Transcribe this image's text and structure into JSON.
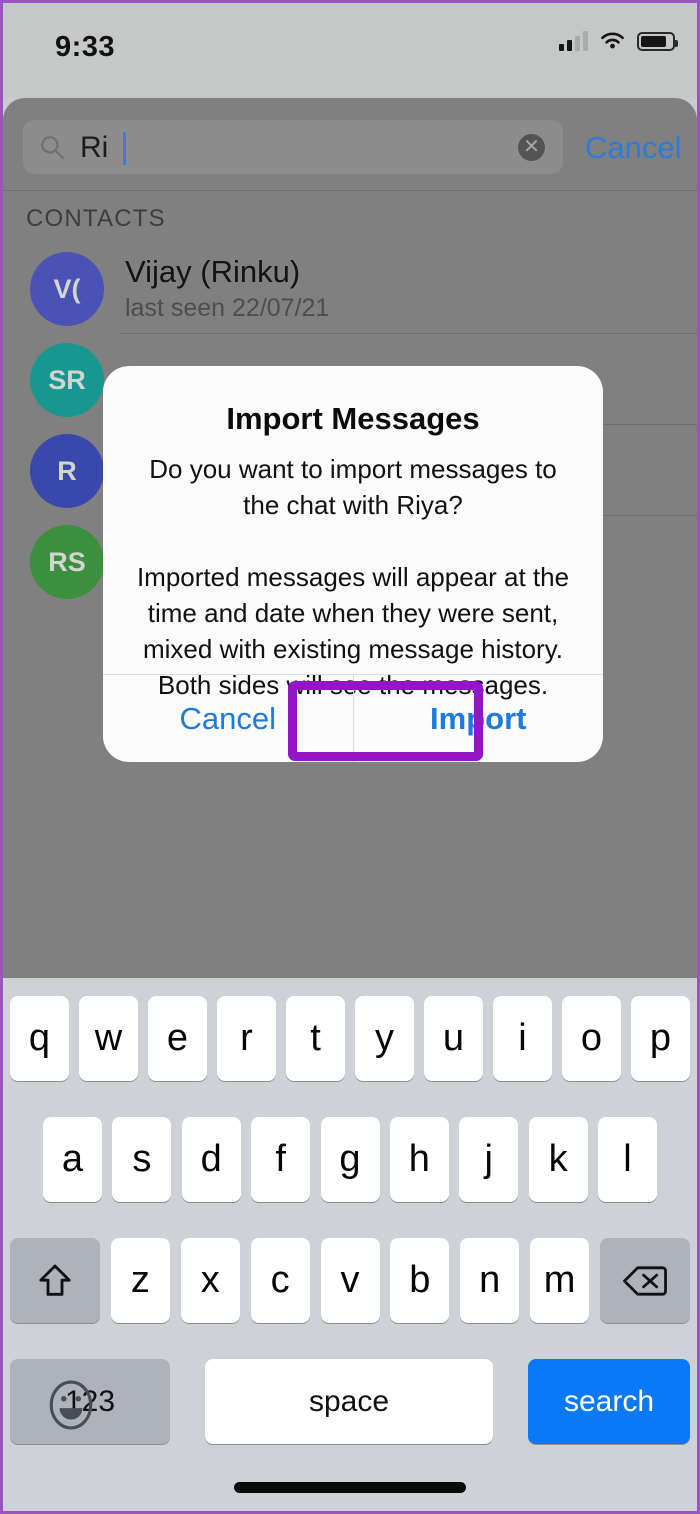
{
  "status_bar": {
    "time": "9:33",
    "cellular_icon": "cellular-signal-icon",
    "wifi_icon": "wifi-icon",
    "battery_icon": "battery-icon"
  },
  "search": {
    "icon": "search-icon",
    "value": "Ri",
    "clear_icon": "clear-circle-icon",
    "clear_glyph": "✕",
    "cancel_label": "Cancel"
  },
  "list": {
    "section_header": "CONTACTS",
    "contacts": [
      {
        "initials": "V(",
        "name": "Vijay (Rinku)",
        "subtitle": "last seen 22/07/21",
        "avatar_color": "#4a52b5"
      },
      {
        "initials": "SR",
        "name": "",
        "subtitle": "",
        "avatar_color": "#17978f"
      },
      {
        "initials": "R",
        "name": "",
        "subtitle": "",
        "avatar_color": "#3a48ab"
      },
      {
        "initials": "RS",
        "name": "",
        "subtitle": "",
        "avatar_color": "#3c8f3f"
      }
    ]
  },
  "dialog": {
    "title": "Import Messages",
    "body": "Do you want to import messages to the chat with Riya?\n\nImported messages will appear at the time and date when they were sent, mixed with existing message history. Both sides will see the messages.",
    "cancel_label": "Cancel",
    "import_label": "Import",
    "highlight_color": "#9314c9",
    "action_color": "#1d7ae0"
  },
  "keyboard": {
    "row1": [
      "q",
      "w",
      "e",
      "r",
      "t",
      "y",
      "u",
      "i",
      "o",
      "p"
    ],
    "row2": [
      "a",
      "s",
      "d",
      "f",
      "g",
      "h",
      "j",
      "k",
      "l"
    ],
    "row3": [
      "z",
      "x",
      "c",
      "v",
      "b",
      "n",
      "m"
    ],
    "shift_icon": "shift-arrow-icon",
    "backspace_icon": "backspace-icon",
    "numbers_label": "123",
    "space_label": "space",
    "search_label": "search",
    "search_key_color": "#0a79f7",
    "emoji_icon": "emoji-smiley-icon"
  },
  "home_indicator": "home-indicator-bar"
}
